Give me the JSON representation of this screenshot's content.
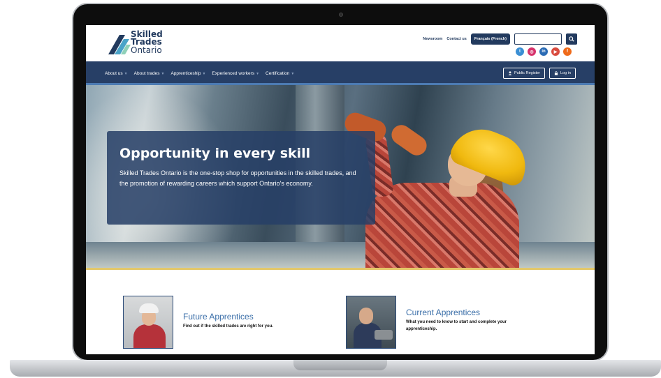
{
  "logo": {
    "line1": "Skilled",
    "line2": "Trades",
    "line3": "Ontario"
  },
  "header": {
    "links": [
      "Newsroom",
      "Contact us"
    ],
    "language_button": "Français (French)",
    "search_placeholder": "",
    "social": [
      {
        "icon": "twitter-icon",
        "glyph": "t",
        "color": "#3b8fd4"
      },
      {
        "icon": "instagram-icon",
        "glyph": "◎",
        "color": "#d6336c"
      },
      {
        "icon": "linkedin-icon",
        "glyph": "in",
        "color": "#2a6bb5"
      },
      {
        "icon": "youtube-icon",
        "glyph": "▶",
        "color": "#d94b3f"
      },
      {
        "icon": "facebook-icon",
        "glyph": "f",
        "color": "#ef6a1a"
      }
    ]
  },
  "nav": {
    "items": [
      "About us",
      "About trades",
      "Apprenticeship",
      "Experienced workers",
      "Certification"
    ],
    "public_register": "Public Register",
    "log_in": "Log in"
  },
  "hero": {
    "title": "Opportunity in every skill",
    "text": "Skilled Trades Ontario is the one-stop shop for opportunities in the skilled trades, and the promotion of rewarding careers which support Ontario's economy."
  },
  "promos": [
    {
      "title": "Future Apprentices",
      "description": "Find out if the skilled trades are right for you."
    },
    {
      "title": "Current Apprentices",
      "description": "What you need to know to start and complete your apprenticeship."
    }
  ]
}
